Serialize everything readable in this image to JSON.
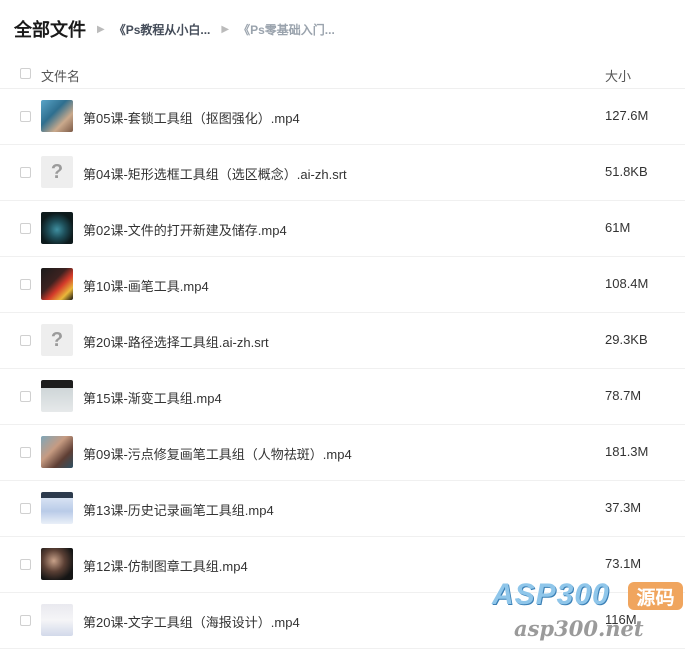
{
  "breadcrumb": {
    "root": "全部文件",
    "items": [
      "《Ps教程从小白...",
      "《Ps零基础入门..."
    ]
  },
  "columns": {
    "name": "文件名",
    "size": "大小"
  },
  "files": [
    {
      "name": "第05课-套锁工具组（抠图强化）.mp4",
      "size": "127.6M"
    },
    {
      "name": "第04课-矩形选框工具组（选区概念）.ai-zh.srt",
      "size": "51.8KB"
    },
    {
      "name": "第02课-文件的打开新建及储存.mp4",
      "size": "61M"
    },
    {
      "name": "第10课-画笔工具.mp4",
      "size": "108.4M"
    },
    {
      "name": "第20课-路径选择工具组.ai-zh.srt",
      "size": "29.3KB"
    },
    {
      "name": "第15课-渐变工具组.mp4",
      "size": "78.7M"
    },
    {
      "name": "第09课-污点修复画笔工具组（人物祛斑）.mp4",
      "size": "181.3M"
    },
    {
      "name": "第13课-历史记录画笔工具组.mp4",
      "size": "37.3M"
    },
    {
      "name": "第12课-仿制图章工具组.mp4",
      "size": "73.1M"
    },
    {
      "name": "第20课-文字工具组（海报设计）.mp4",
      "size": "116M"
    }
  ],
  "unknown_glyph": "?",
  "watermark": {
    "brand": "ASP300",
    "badge": "源码",
    "url": "asp300.net"
  }
}
